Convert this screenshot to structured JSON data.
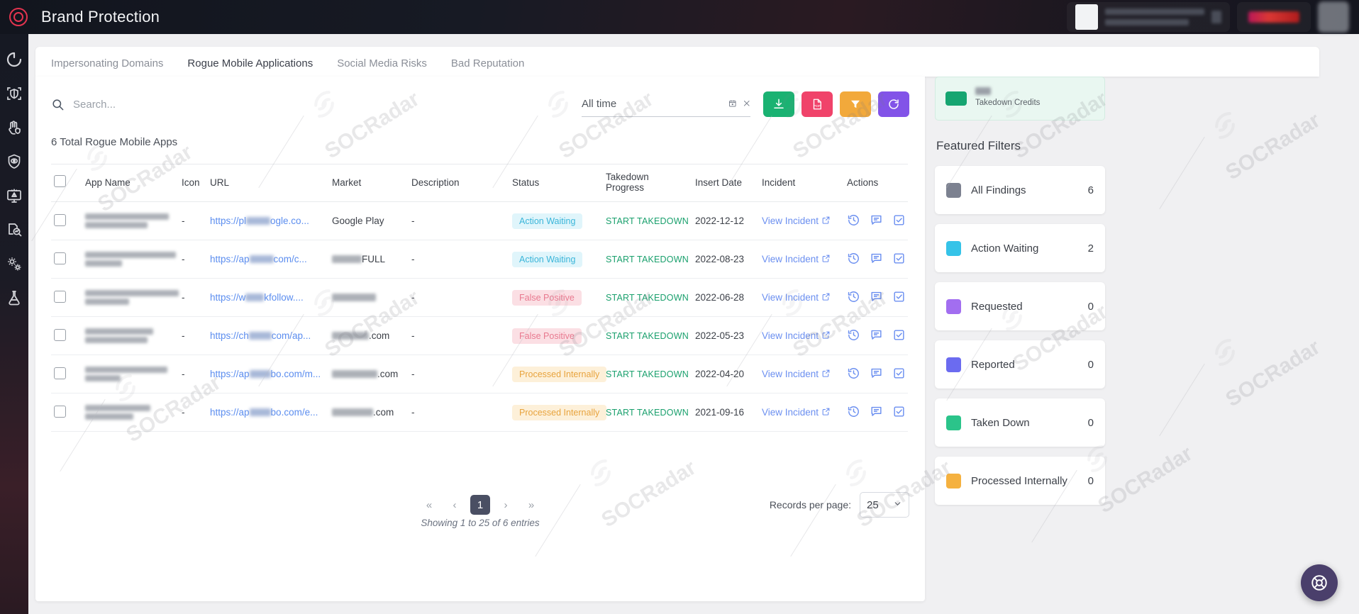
{
  "app": {
    "title": "Brand Protection",
    "logo_icon": "socradar-ring-logo",
    "accent_red": "#e3344f"
  },
  "topbar": {
    "tenant_chip": {
      "name": "tenant-selector",
      "redacted": true
    },
    "org_chip": {
      "name": "organization-badge",
      "redacted": true
    },
    "avatar": {
      "name": "user-avatar",
      "redacted": true
    }
  },
  "sidebar": {
    "items": [
      {
        "icon": "refresh-dashboard-icon",
        "label": "Dashboard"
      },
      {
        "icon": "shield-scan-icon",
        "label": "Attack Surface"
      },
      {
        "icon": "hand-shield-icon",
        "label": "Brand Protection"
      },
      {
        "icon": "eye-shield-icon",
        "label": "Dark Web Monitoring"
      },
      {
        "icon": "monitor-alert-icon",
        "label": "Cyber Threat Intelligence"
      },
      {
        "icon": "document-search-icon",
        "label": "Threat Hunting"
      },
      {
        "icon": "gears-icon",
        "label": "Settings"
      },
      {
        "icon": "flask-icon",
        "label": "Labs"
      }
    ]
  },
  "tabs": [
    {
      "label": "Impersonating Domains",
      "active": false
    },
    {
      "label": "Rogue Mobile Applications",
      "active": true
    },
    {
      "label": "Social Media Risks",
      "active": false
    },
    {
      "label": "Bad Reputation",
      "active": false
    }
  ],
  "toolbar": {
    "search_placeholder": "Search...",
    "search_value": "",
    "search_icon": "search-icon",
    "date_value": "",
    "date_placeholder": "All time",
    "calendar_icon": "calendar-icon",
    "clear_icon": "close-icon",
    "buttons": [
      {
        "name": "export-button",
        "icon": "download-icon",
        "color": "#1ab272"
      },
      {
        "name": "pdf-export-button",
        "icon": "pdf-icon",
        "color": "#f0436a"
      },
      {
        "name": "filter-button",
        "icon": "filter-icon",
        "color": "#f2a93b"
      },
      {
        "name": "refresh-button",
        "icon": "refresh-icon",
        "color": "#8253e8"
      }
    ]
  },
  "table": {
    "total_label": "6 Total Rogue Mobile Apps",
    "columns": [
      "App Name",
      "Icon",
      "URL",
      "Market",
      "Description",
      "Status",
      "Takedown Progress",
      "Insert Date",
      "Incident",
      "Actions"
    ],
    "takedown_label": "START TAKEDOWN",
    "incident_label": "View Incident",
    "rows": [
      {
        "app_name_redacted": [
          118,
          88
        ],
        "icon": "-",
        "url_prefix": "https://pl",
        "url_suffix": "ogle.co...",
        "url_blur_width": 34,
        "market": "Google Play",
        "market_blur": 0,
        "description": "-",
        "status": "Action Waiting",
        "status_style": "b-wait",
        "insert_date": "2022-12-12"
      },
      {
        "app_name_redacted": [
          128,
          52
        ],
        "icon": "-",
        "url_prefix": "https://ap",
        "url_suffix": "com/c...",
        "url_blur_width": 34,
        "market": "FULL",
        "market_blur": 42,
        "description": "-",
        "status": "Action Waiting",
        "status_style": "b-wait",
        "insert_date": "2022-08-23"
      },
      {
        "app_name_redacted": [
          132,
          62
        ],
        "icon": "-",
        "url_prefix": "https://w",
        "url_suffix": "kfollow....",
        "url_blur_width": 26,
        "market": "",
        "market_blur": 62,
        "description": "-",
        "status": "False Positive",
        "status_style": "b-fp",
        "insert_date": "2022-06-28"
      },
      {
        "app_name_redacted": [
          96,
          88
        ],
        "icon": "-",
        "url_prefix": "https://ch",
        "url_suffix": "com/ap...",
        "url_blur_width": 32,
        "market": ".com",
        "market_blur": 52,
        "description": "-",
        "status": "False Positive",
        "status_style": "b-fp",
        "insert_date": "2022-05-23"
      },
      {
        "app_name_redacted": [
          116,
          50
        ],
        "icon": "-",
        "url_prefix": "https://ap",
        "url_suffix": "bo.com/m...",
        "url_blur_width": 30,
        "market": ".com",
        "market_blur": 64,
        "description": "-",
        "status": "Processed Internally",
        "status_style": "b-pi",
        "insert_date": "2022-04-20"
      },
      {
        "app_name_redacted": [
          92,
          68
        ],
        "icon": "-",
        "url_prefix": "https://ap",
        "url_suffix": "bo.com/e...",
        "url_blur_width": 30,
        "market": ".com",
        "market_blur": 58,
        "description": "-",
        "status": "Processed Internally",
        "status_style": "b-pi",
        "insert_date": "2021-09-16"
      }
    ],
    "action_icons": [
      "history-icon",
      "comment-icon",
      "checkbox-check-icon"
    ],
    "external_link_icon": "external-link-icon"
  },
  "pagination": {
    "first_icon": "chevron-double-left-icon",
    "prev_icon": "chevron-left-icon",
    "next_icon": "chevron-right-icon",
    "last_icon": "chevron-double-right-icon",
    "current_page": "1",
    "records_label": "Records per page:",
    "records_value": "25",
    "showing_text": "Showing 1 to 25 of 6 entries"
  },
  "right_panel": {
    "credits": {
      "label": "Takedown Credits",
      "icon": "credit-card-icon",
      "redacted_value": true
    },
    "featured_filters_title": "Featured Filters",
    "filters": [
      {
        "label": "All Findings",
        "count": "6",
        "color": "#7c8190"
      },
      {
        "label": "Action Waiting",
        "count": "2",
        "color": "#35c3e8"
      },
      {
        "label": "Requested",
        "count": "0",
        "color": "#a26ef0"
      },
      {
        "label": "Reported",
        "count": "0",
        "color": "#6b6bf0"
      },
      {
        "label": "Taken Down",
        "count": "0",
        "color": "#2bc48a"
      },
      {
        "label": "Processed Internally",
        "count": "0",
        "color": "#f5b13f"
      }
    ]
  },
  "fab": {
    "icon": "support-lifebuoy-icon",
    "color": "#4a3f6b"
  },
  "watermark": {
    "text": "SOCRadar"
  }
}
